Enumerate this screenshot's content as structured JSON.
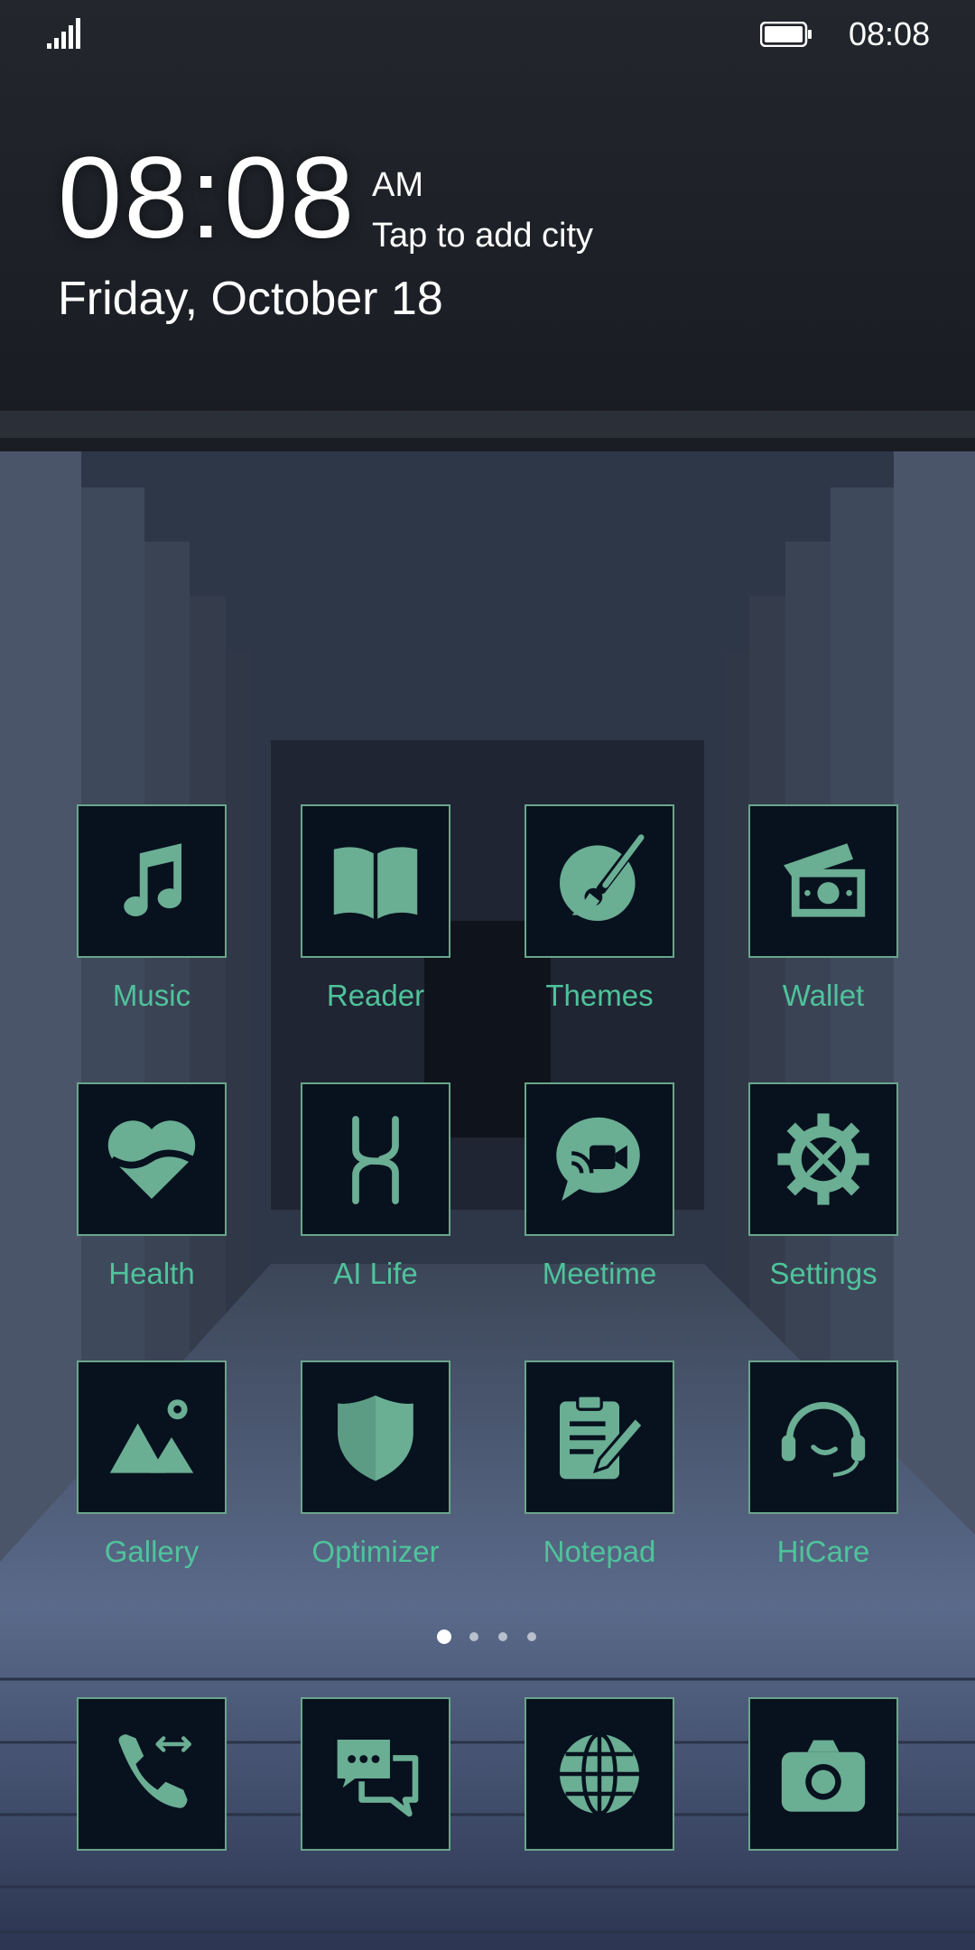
{
  "status_bar": {
    "time": "08:08"
  },
  "widget": {
    "time": "08:08",
    "ampm": "AM",
    "city_prompt": "Tap to add city",
    "date": "Friday, October 18"
  },
  "apps": [
    {
      "label": "Music",
      "icon": "music-note-icon"
    },
    {
      "label": "Reader",
      "icon": "book-icon"
    },
    {
      "label": "Themes",
      "icon": "paintbrush-icon"
    },
    {
      "label": "Wallet",
      "icon": "wallet-icon"
    },
    {
      "label": "Health",
      "icon": "heart-icon"
    },
    {
      "label": "AI Life",
      "icon": "ai-life-icon"
    },
    {
      "label": "Meetime",
      "icon": "video-chat-icon"
    },
    {
      "label": "Settings",
      "icon": "gear-icon"
    },
    {
      "label": "Gallery",
      "icon": "gallery-icon"
    },
    {
      "label": "Optimizer",
      "icon": "shield-icon"
    },
    {
      "label": "Notepad",
      "icon": "notepad-icon"
    },
    {
      "label": "HiCare",
      "icon": "headset-icon"
    }
  ],
  "dock": [
    {
      "icon": "phone-icon"
    },
    {
      "icon": "messages-icon"
    },
    {
      "icon": "globe-icon"
    },
    {
      "icon": "camera-icon"
    }
  ],
  "pages": {
    "count": 4,
    "active": 1
  },
  "colors": {
    "accent": "#4fc39b",
    "tile_bg": "#08111e",
    "tile_border": "#6aa58c",
    "icon": "#6aae94"
  }
}
